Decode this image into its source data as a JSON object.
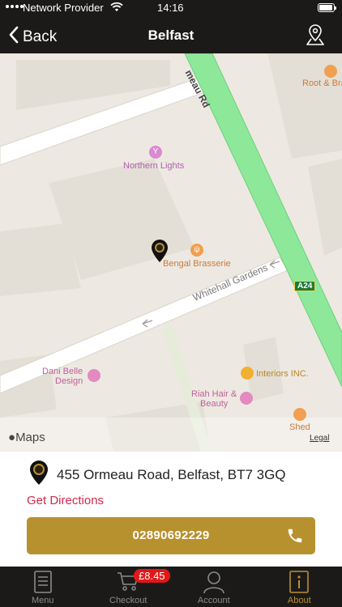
{
  "status_bar": {
    "carrier": "Network Provider",
    "time": "14:16"
  },
  "nav": {
    "back_label": "Back",
    "title": "Belfast"
  },
  "map": {
    "road_major": "meau Rd",
    "road_minor": "Whitehall Gardens",
    "route_shield": "A24",
    "pois": {
      "root_and_bran": "Root & Bra",
      "northern_lights": "Northern Lights",
      "bengal_brasserie": "Bengal Brasserie",
      "dani_belle_line1": "Dani Belle",
      "dani_belle_line2": "Design",
      "interiors_inc": "Interiors INC.",
      "riah_hair_line1": "Riah Hair &",
      "riah_hair_line2": "Beauty",
      "shed": "Shed"
    },
    "attribution": "Maps",
    "legal": "Legal"
  },
  "location": {
    "address": "455 Ormeau Road, Belfast, BT7 3GQ",
    "directions_label": "Get Directions",
    "phone": "02890692229"
  },
  "tabs": [
    {
      "label": "Menu",
      "icon": "menu-icon"
    },
    {
      "label": "Checkout",
      "icon": "cart-icon",
      "badge": "£8.45"
    },
    {
      "label": "Account",
      "icon": "account-icon"
    },
    {
      "label": "About",
      "icon": "info-icon",
      "active": true
    }
  ],
  "colors": {
    "header_bg": "#1c1a19",
    "accent_gold": "#b8912f",
    "directions_red": "#d0294b",
    "badge_red": "#e01818",
    "map_road_green": "#8ee89a"
  }
}
